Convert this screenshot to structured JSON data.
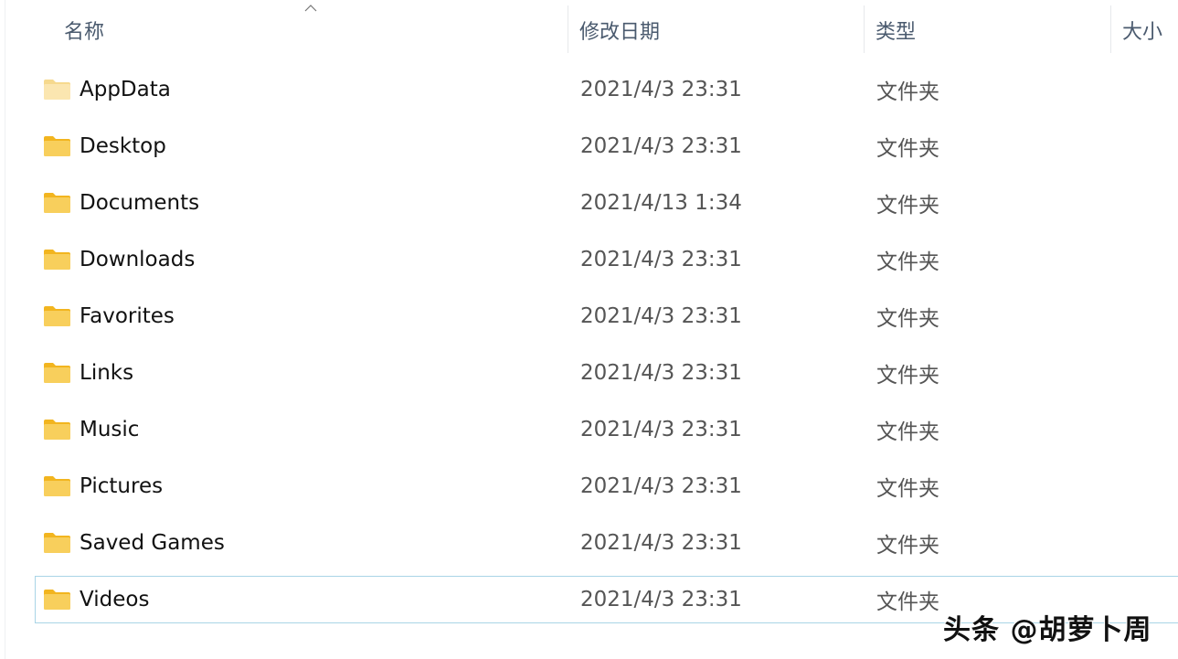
{
  "header": {
    "columns": [
      {
        "key": "name",
        "label": "名称"
      },
      {
        "key": "modified",
        "label": "修改日期"
      },
      {
        "key": "type",
        "label": "类型"
      },
      {
        "key": "size",
        "label": "大小"
      }
    ],
    "sort_indicator": "ascending"
  },
  "rows": [
    {
      "name": "AppData",
      "modified": "2021/4/3 23:31",
      "type": "文件夹",
      "icon": "folder-hidden-icon"
    },
    {
      "name": "Desktop",
      "modified": "2021/4/3 23:31",
      "type": "文件夹",
      "icon": "folder-icon"
    },
    {
      "name": "Documents",
      "modified": "2021/4/13 1:34",
      "type": "文件夹",
      "icon": "folder-icon"
    },
    {
      "name": "Downloads",
      "modified": "2021/4/3 23:31",
      "type": "文件夹",
      "icon": "folder-icon"
    },
    {
      "name": "Favorites",
      "modified": "2021/4/3 23:31",
      "type": "文件夹",
      "icon": "folder-icon"
    },
    {
      "name": "Links",
      "modified": "2021/4/3 23:31",
      "type": "文件夹",
      "icon": "folder-icon"
    },
    {
      "name": "Music",
      "modified": "2021/4/3 23:31",
      "type": "文件夹",
      "icon": "folder-icon"
    },
    {
      "name": "Pictures",
      "modified": "2021/4/3 23:31",
      "type": "文件夹",
      "icon": "folder-icon"
    },
    {
      "name": "Saved Games",
      "modified": "2021/4/3 23:31",
      "type": "文件夹",
      "icon": "folder-icon"
    },
    {
      "name": "Videos",
      "modified": "2021/4/3 23:31",
      "type": "文件夹",
      "icon": "folder-icon",
      "selected": true
    }
  ],
  "watermark": "头条 @胡萝卜周",
  "colors": {
    "header_text": "#4a5a6e",
    "selection_border": "#a9d4e6",
    "folder_body": "#f8cf5c",
    "folder_tab": "#f2b51f"
  }
}
